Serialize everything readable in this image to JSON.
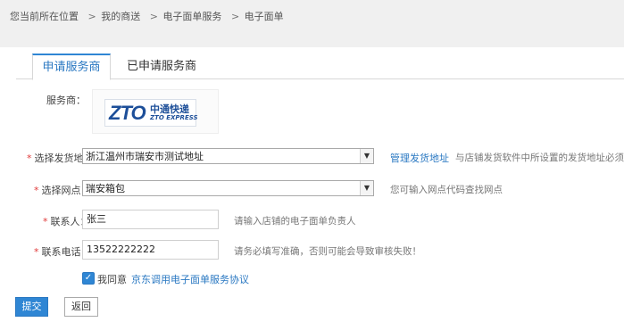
{
  "breadcrumb": {
    "items": [
      "您当前所在位置",
      "我的商送",
      "电子面单服务",
      "电子面单"
    ],
    "separator": ">"
  },
  "tabs": [
    {
      "label": "申请服务商",
      "active": true
    },
    {
      "label": "已申请服务商",
      "active": false
    }
  ],
  "form": {
    "provider": {
      "label": "服务商：",
      "logo_cn": "中通快递",
      "logo_en": "ZTO EXPRESS",
      "logo_mark": "ZTO"
    },
    "address": {
      "label": "选择发货地：",
      "value": "浙江温州市瑞安市测试地址",
      "link": "管理发货地址",
      "hint": "与店铺发货软件中所设置的发货地址必须一样"
    },
    "branch": {
      "label": "选择网点：",
      "value": "瑞安箱包",
      "hint": "您可输入网点代码查找网点"
    },
    "contact": {
      "label": "联系人：",
      "value": "张三",
      "hint": "请输入店铺的电子面单负责人"
    },
    "phone": {
      "label": "联系电话：",
      "value": "13522222222",
      "hint": "请务必填写准确，否则可能会导致审核失败！"
    },
    "agreement": {
      "label": "我同意",
      "link": "京东调用电子面单服务协议",
      "checked": true
    }
  },
  "buttons": {
    "submit": "提交",
    "back": "返回"
  },
  "colors": {
    "accent": "#2f86d4",
    "link": "#2a78c2",
    "required": "#e03b3b"
  }
}
